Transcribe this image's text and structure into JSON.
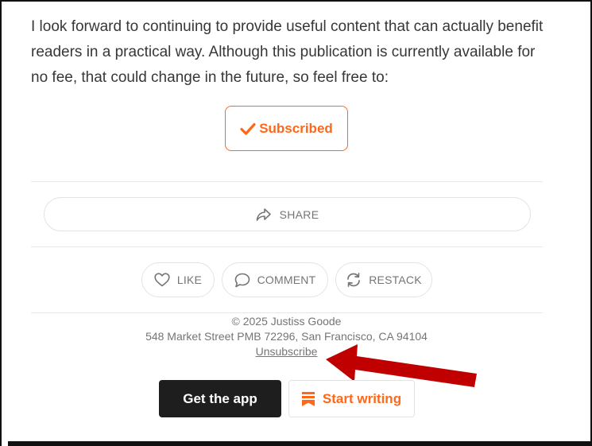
{
  "post": {
    "closing_paragraph": "I look forward to continuing to provide useful content that can actually benefit readers in a practical way. Although this publication is currently available for no fee, that could change in the future, so feel free to:"
  },
  "subscribe_button": {
    "label": "Subscribed",
    "icon": "checkmark-icon"
  },
  "share_button": {
    "label": "SHARE",
    "icon": "share-arrow-icon"
  },
  "actions": {
    "like": {
      "label": "LIKE",
      "icon": "heart-icon"
    },
    "comment": {
      "label": "COMMENT",
      "icon": "speech-bubble-icon"
    },
    "restack": {
      "label": "RESTACK",
      "icon": "restack-icon"
    }
  },
  "footer": {
    "copyright": "© 2025 Justiss Goode",
    "address": "548 Market Street PMB 72296, San Francisco, CA 94104",
    "unsubscribe": "Unsubscribe"
  },
  "cta": {
    "get_app": "Get the app",
    "start_writing": "Start writing",
    "start_writing_icon": "substack-logo-icon"
  },
  "colors": {
    "accent": "#ff6719",
    "annotation_arrow": "#c00000",
    "dark_button": "#1e1e1e",
    "muted_text": "#757575"
  }
}
